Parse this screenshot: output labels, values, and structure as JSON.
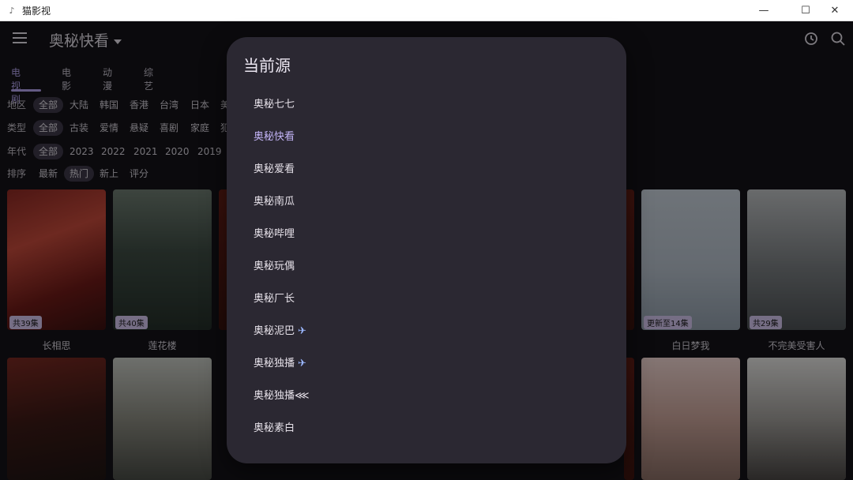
{
  "window": {
    "title": "猫影视",
    "controls": [
      "—",
      "☐",
      "✕"
    ]
  },
  "app": {
    "source_title": "奥秘快看",
    "icons": [
      "menu-icon",
      "history-icon",
      "search-icon"
    ]
  },
  "tabs": [
    "电视剧",
    "电影",
    "动漫",
    "综艺"
  ],
  "filters": {
    "region": {
      "label": "地区",
      "items": [
        "全部",
        "大陆",
        "韩国",
        "香港",
        "台湾",
        "日本",
        "美"
      ]
    },
    "type": {
      "label": "类型",
      "items": [
        "全部",
        "古装",
        "爱情",
        "悬疑",
        "喜剧",
        "家庭",
        "犯"
      ]
    },
    "year": {
      "label": "年代",
      "items": [
        "全部",
        "2023",
        "2022",
        "2021",
        "2020",
        "2019"
      ]
    },
    "sort": {
      "label": "排序",
      "items": [
        "最新",
        "热门",
        "新上",
        "评分"
      ]
    }
  },
  "row1": [
    {
      "title": "长相思",
      "badge": "共39集"
    },
    {
      "title": "莲花楼",
      "badge": "共40集"
    },
    {
      "title": "白日梦我",
      "badge": "更新至14集"
    },
    {
      "title": "不完美受害人",
      "badge": "共29集"
    }
  ],
  "row2_posters": [
    "",
    "",
    "",
    ""
  ],
  "dialog": {
    "title": "当前源",
    "selected_index": 1,
    "options": [
      "奥秘七七",
      "奥秘快看",
      "奥秘爱看",
      "奥秘南瓜",
      "奥秘哔哩",
      "奥秘玩偶",
      "奥秘厂长",
      "奥秘泥巴",
      "奥秘独播",
      "奥秘独播⋘",
      "奥秘素白"
    ],
    "option_badges": {
      "7": "✈",
      "8": "✈"
    }
  },
  "colors": {
    "accent": "#b7a6f0",
    "dialog_bg": "#2b2832",
    "app_bg": "#141318"
  }
}
